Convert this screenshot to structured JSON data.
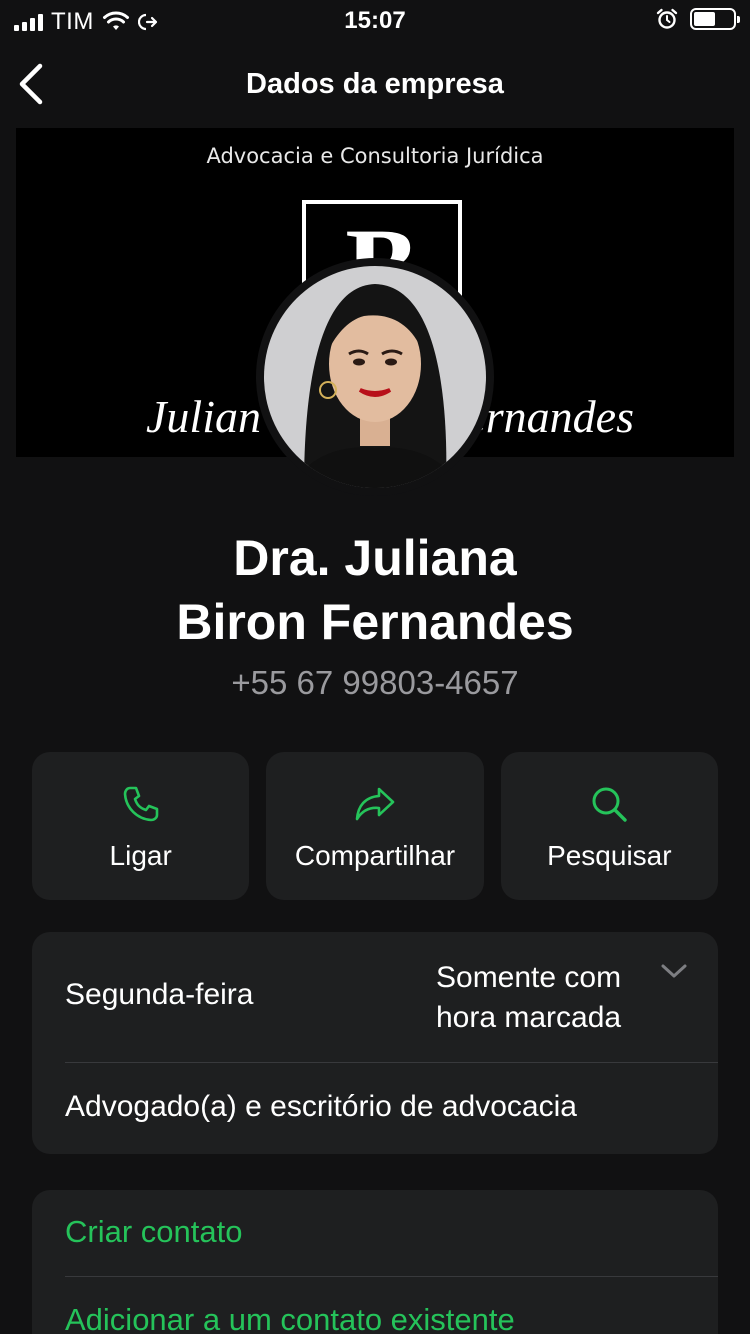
{
  "status_bar": {
    "carrier": "TIM",
    "time": "15:07",
    "battery_level": 0.55
  },
  "nav": {
    "title": "Dados da empresa"
  },
  "cover": {
    "caption": "Advocacia e Consultoria Jurídica",
    "logo_letter": "B",
    "script_left": "Julian",
    "script_right": "ernandes"
  },
  "profile": {
    "name_line1": "Dra. Juliana",
    "name_line2": "Biron Fernandes",
    "phone": "+55 67 99803-4657"
  },
  "actions": [
    {
      "label": "Ligar",
      "icon": "phone-icon"
    },
    {
      "label": "Compartilhar",
      "icon": "share-icon"
    },
    {
      "label": "Pesquisar",
      "icon": "search-icon"
    }
  ],
  "info": {
    "day": "Segunda-feira",
    "hours_line1": "Somente com",
    "hours_line2": "hora marcada",
    "category": "Advogado(a) e escritório de advocacia"
  },
  "contact": {
    "create": "Criar contato",
    "add_existing": "Adicionar a um contato existente"
  },
  "colors": {
    "accent": "#25c35a",
    "background": "#111112",
    "card": "#1e1f20",
    "secondary_text": "#9a9a9e"
  }
}
